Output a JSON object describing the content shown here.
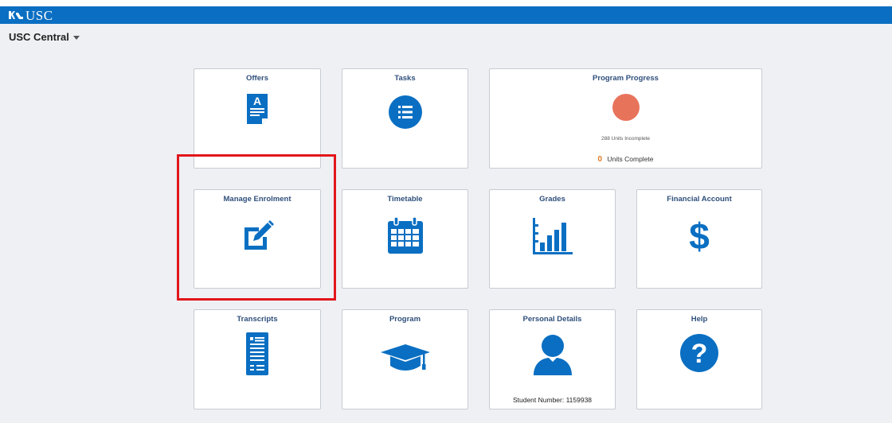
{
  "brand": {
    "name": "USC",
    "bar_color": "#0a6fc2"
  },
  "nav": {
    "title": "USC Central",
    "dropdown_icon": "caret-down-icon"
  },
  "highlight_color": "#e2161b",
  "tiles": {
    "offers": {
      "title": "Offers",
      "icon": "document-a-icon"
    },
    "tasks": {
      "title": "Tasks",
      "icon": "list-icon"
    },
    "program_progress": {
      "title": "Program Progress",
      "chart_label": "288 Units Incomplete",
      "units_complete_value": "0",
      "units_complete_label": "Units Complete",
      "chart_color": "#e8735b"
    },
    "manage_enrolment": {
      "title": "Manage Enrolment",
      "icon": "edit-icon"
    },
    "timetable": {
      "title": "Timetable",
      "icon": "calendar-icon"
    },
    "grades": {
      "title": "Grades",
      "icon": "bar-chart-icon"
    },
    "financial_account": {
      "title": "Financial Account",
      "icon": "dollar-icon"
    },
    "transcripts": {
      "title": "Transcripts",
      "icon": "transcript-icon"
    },
    "program": {
      "title": "Program",
      "icon": "graduation-cap-icon"
    },
    "personal_details": {
      "title": "Personal Details",
      "icon": "person-icon",
      "student_number": "Student Number: 1159938"
    },
    "help": {
      "title": "Help",
      "icon": "question-icon"
    }
  },
  "icon_color": "#0a6fc2"
}
